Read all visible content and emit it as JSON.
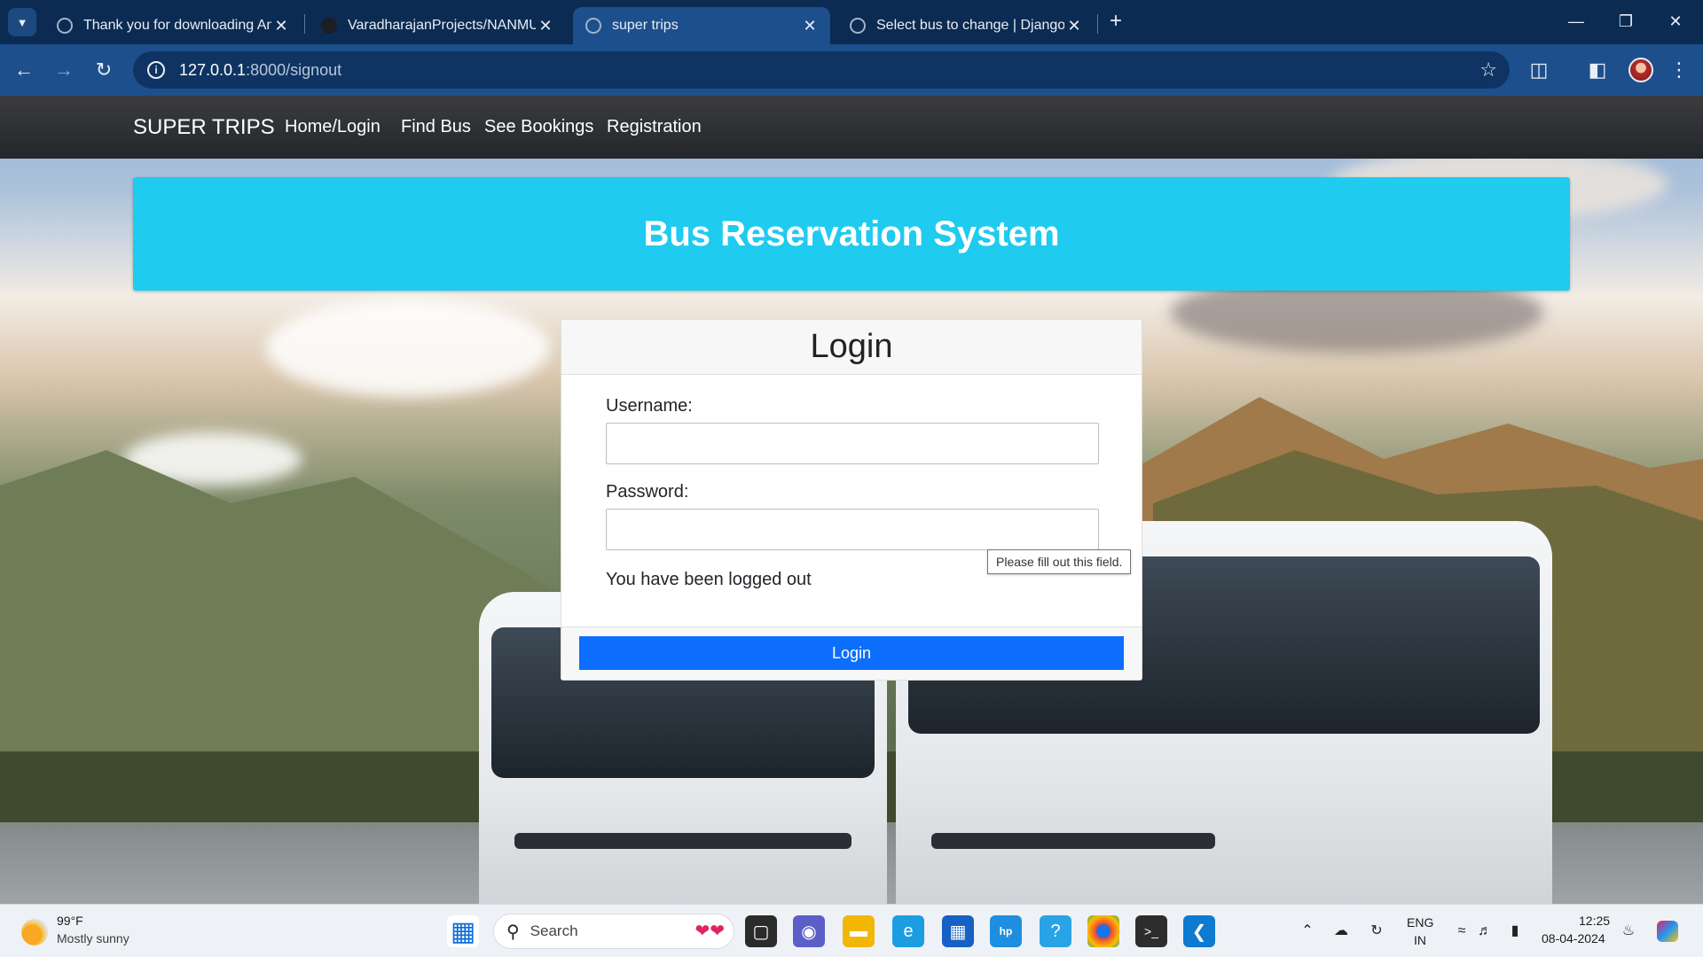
{
  "browser": {
    "tabs": [
      {
        "title": "Thank you for downloading Any",
        "active": false
      },
      {
        "title": "VaradharajanProjects/NANMUD",
        "active": false
      },
      {
        "title": "super trips",
        "active": true
      },
      {
        "title": "Select bus to change | Django s",
        "active": false
      }
    ],
    "url_host": "127.0.0.1",
    "url_path": ":8000/signout"
  },
  "site": {
    "brand": "SUPER TRIPS",
    "nav": [
      "Home/Login",
      "Find Bus",
      "See Bookings",
      "Registration"
    ],
    "hero_title": "Bus Reservation System"
  },
  "login": {
    "title": "Login",
    "username_label": "Username:",
    "username_value": "",
    "password_label": "Password:",
    "password_value": "",
    "message": "You have been logged out",
    "button_label": "Login",
    "validation_tooltip": "Please fill out this field."
  },
  "taskbar": {
    "weather_temp": "99°F",
    "weather_desc": "Mostly sunny",
    "search_label": "Search",
    "language_top": "ENG",
    "language_bottom": "IN",
    "time": "12:25",
    "date": "08-04-2024"
  },
  "colors": {
    "hero": "#1fcbef",
    "login_button": "#0d6efd",
    "chrome_tabbar": "#0c2b52",
    "chrome_toolbar": "#1d4f8c"
  }
}
